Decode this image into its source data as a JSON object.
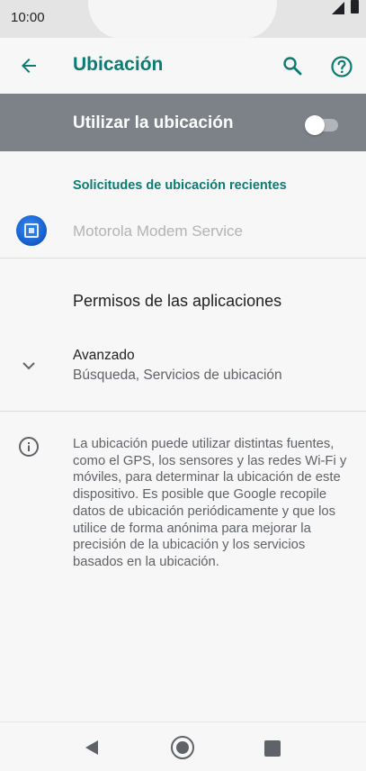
{
  "status_bar": {
    "time": "10:00"
  },
  "app_bar": {
    "title": "Ubicación"
  },
  "master_switch": {
    "label": "Utilizar la ubicación",
    "state": "off"
  },
  "recent_requests": {
    "header": "Solicitudes de ubicación recientes",
    "items": [
      {
        "name": "Motorola Modem Service"
      }
    ]
  },
  "permissions": {
    "label": "Permisos de las aplicaciones"
  },
  "advanced": {
    "title": "Avanzado",
    "subtitle": "Búsqueda, Servicios de ubicación"
  },
  "info": {
    "text": "La ubicación puede utilizar distintas fuentes, como el GPS, los sensores y las redes Wi-Fi y móviles, para determinar la ubicación de este dispositivo. Es posible que Google recopile datos de ubicación periódicamente y que los utilice de forma anónima para mejorar la precisión de la ubicación y los servicios basados en la ubicación."
  },
  "colors": {
    "accent": "#0b7c74",
    "switch_bar": "#7d8288",
    "background": "#f7f7f7"
  },
  "icons": {
    "back": "arrow-left-icon",
    "search": "search-icon",
    "help": "help-icon",
    "chevron": "chevron-down-icon",
    "info": "info-icon",
    "nav_back": "triangle-back-icon",
    "nav_home": "home-circle-icon",
    "nav_recents": "square-recents-icon"
  }
}
